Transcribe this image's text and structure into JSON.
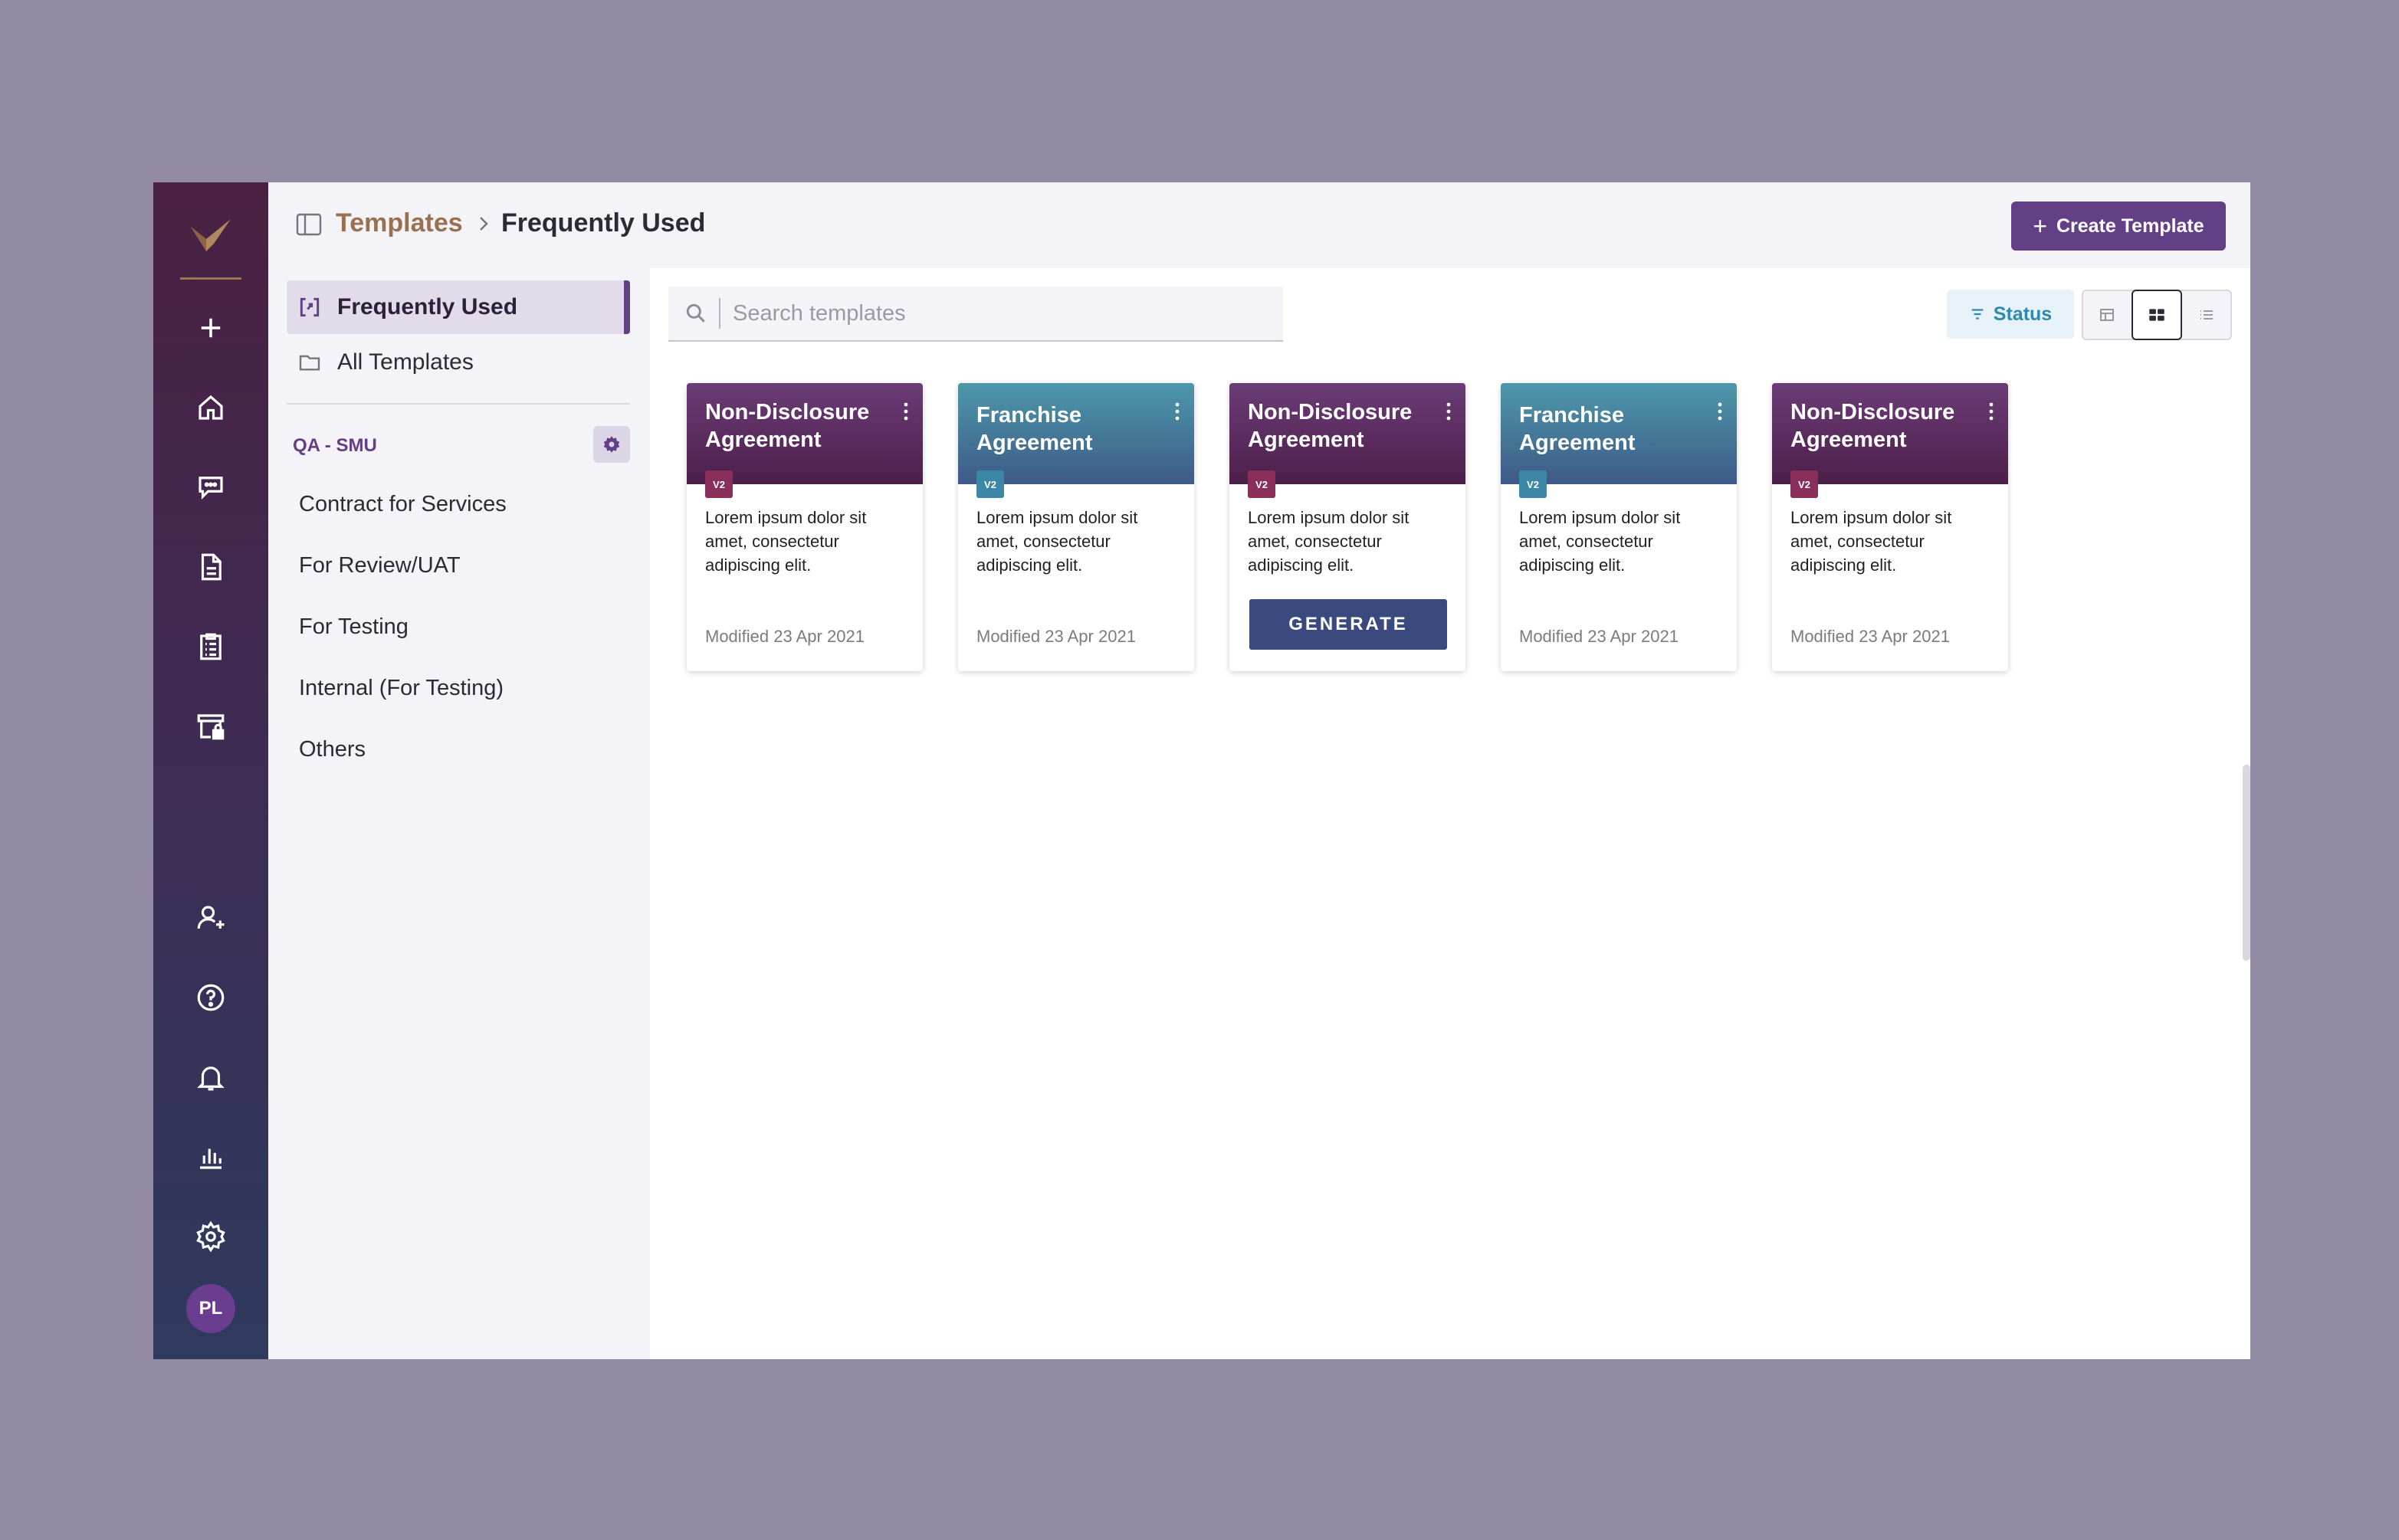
{
  "breadcrumb": {
    "root": "Templates",
    "current": "Frequently Used"
  },
  "header": {
    "create_label": "Create Template"
  },
  "rail": {
    "icons": [
      "plus-icon",
      "home-icon",
      "chat-icon",
      "document-icon",
      "checklist-icon",
      "archive-lock-icon",
      "add-user-icon",
      "help-icon",
      "bell-icon",
      "bar-chart-icon",
      "gear-icon"
    ],
    "avatar_initials": "PL"
  },
  "sidebar": {
    "nav": [
      {
        "label": "Frequently Used",
        "icon": "frequent-icon",
        "active": true
      },
      {
        "label": "All Templates",
        "icon": "folder-icon",
        "active": false
      }
    ],
    "group_label": "QA - SMU",
    "folders": [
      "Contract for Services",
      "For Review/UAT",
      "For Testing",
      "Internal (For Testing)",
      "Others"
    ]
  },
  "search": {
    "placeholder": "Search templates"
  },
  "toolbar": {
    "status_label": "Status",
    "view_modes": [
      "table-view-icon",
      "grid-view-icon",
      "list-view-icon"
    ],
    "active_view": "grid-view-icon"
  },
  "cards": [
    {
      "title": "Non-Disclosure Agreement",
      "version": "V2",
      "theme": "nda",
      "description": "Lorem ipsum dolor sit amet, consectetur adipiscing elit.",
      "modified": "Modified 23 Apr 2021"
    },
    {
      "title": "Franchise Agreement",
      "version": "V2",
      "theme": "fr",
      "description": "Lorem ipsum dolor sit amet, consectetur adipiscing elit.",
      "modified": "Modified 23 Apr 2021"
    },
    {
      "title": "Non-Disclosure Agreement",
      "version": "V2",
      "theme": "nda",
      "description": "Lorem ipsum dolor sit amet, consectetur adipiscing elit.",
      "action": "GENERATE"
    },
    {
      "title": "Franchise Agreement",
      "version": "V2",
      "theme": "fr",
      "description": "Lorem ipsum dolor sit amet, consectetur adipiscing elit.",
      "modified": "Modified 23 Apr 2021"
    },
    {
      "title": "Non-Disclosure Agreement",
      "version": "V2",
      "theme": "nda",
      "description": "Lorem ipsum dolor sit amet, consectetur adipiscing elit.",
      "modified": "Modified 23 Apr 2021"
    }
  ],
  "colors": {
    "accent": "#633f86",
    "breadcrumb_root": "#9a7150",
    "status": "#2f8ab0",
    "generate": "#3b4a7e"
  }
}
